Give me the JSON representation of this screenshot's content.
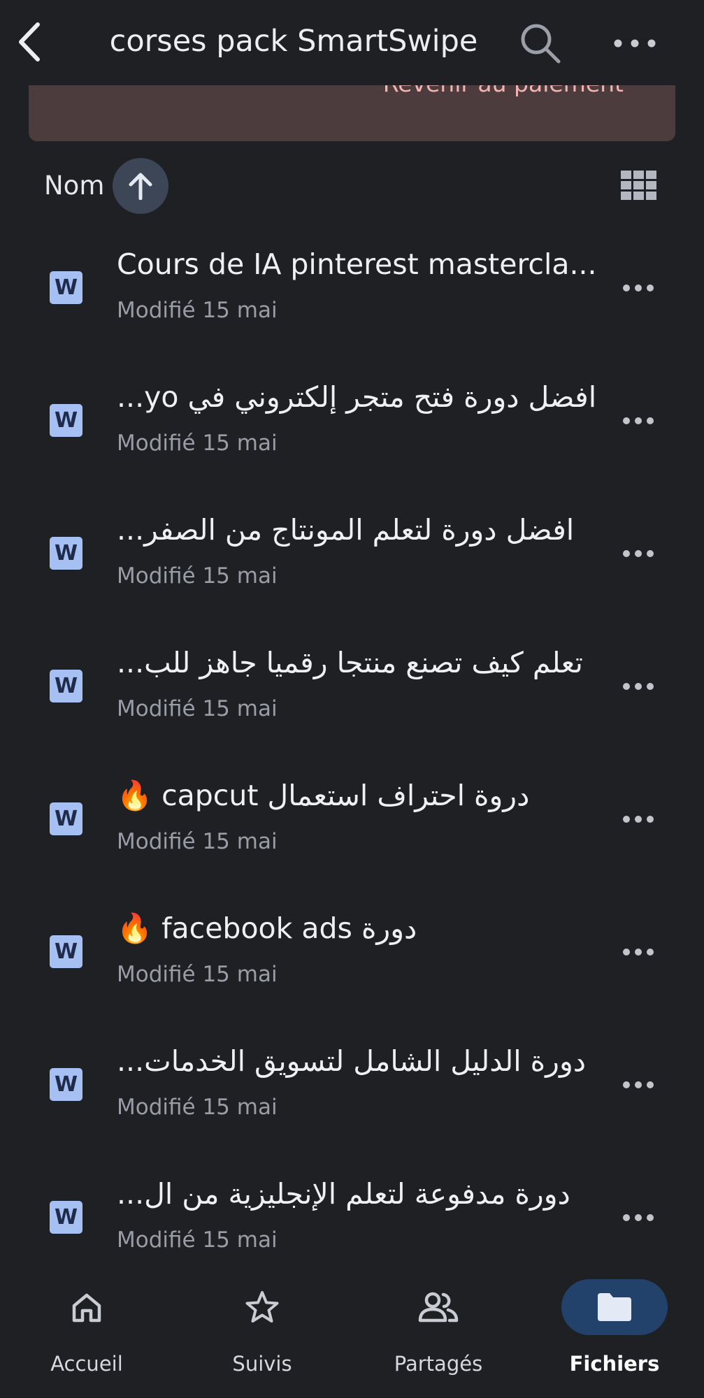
{
  "header": {
    "title": "corses pack SmartSwipe",
    "back_icon": "chevron-left-icon",
    "search_icon": "search-icon",
    "more_icon": "more-horizontal-icon"
  },
  "banner": {
    "action_label": "Revenir au paiement"
  },
  "sort": {
    "label": "Nom",
    "direction_icon": "arrow-up-icon",
    "view_icon": "grid-view-icon"
  },
  "files": [
    {
      "name": "Cours de IA pinterest mastercla...",
      "dir": "ltr",
      "meta": "Modifié 15 mai",
      "type": "word-doc-icon"
    },
    {
      "name": "افضل دورة فتح متجر إلكتروني في yo...",
      "dir": "rtl",
      "meta": "Modifié 15 mai",
      "type": "word-doc-icon"
    },
    {
      "name": "افضل دورة لتعلم المونتاج من الصفر...",
      "dir": "rtl",
      "meta": "Modifié 15 mai",
      "type": "word-doc-icon"
    },
    {
      "name": "تعلم كيف تصنع منتجا رقميا جاهز للب...",
      "dir": "rtl",
      "meta": "Modifié 15 mai",
      "type": "word-doc-icon"
    },
    {
      "name": "دروة احتراف استعمال capcut 🔥",
      "dir": "rtl",
      "meta": "Modifié 15 mai",
      "type": "word-doc-icon"
    },
    {
      "name": "دورة facebook ads 🔥",
      "dir": "rtl",
      "meta": "Modifié 15 mai",
      "type": "word-doc-icon"
    },
    {
      "name": "دورة الدليل الشامل لتسويق الخدمات...",
      "dir": "rtl",
      "meta": "Modifié 15 mai",
      "type": "word-doc-icon"
    },
    {
      "name": "دورة مدفوعة لتعلم الإنجليزية من ال...",
      "dir": "rtl",
      "meta": "Modifié 15 mai",
      "type": "word-doc-icon"
    }
  ],
  "doc_badge_letter": "W",
  "bottom_nav": [
    {
      "label": "Accueil",
      "icon": "home-icon",
      "active": false
    },
    {
      "label": "Suivis",
      "icon": "star-icon",
      "active": false
    },
    {
      "label": "Partagés",
      "icon": "people-icon",
      "active": false
    },
    {
      "label": "Fichiers",
      "icon": "folder-icon",
      "active": true
    }
  ],
  "colors": {
    "background": "#1f2024",
    "banner": "#4c3c3e",
    "banner_text": "#f2b3b3",
    "accent_pill": "#22426b",
    "sort_button": "#3d4656",
    "doc_icon": "#a7c0f4"
  }
}
